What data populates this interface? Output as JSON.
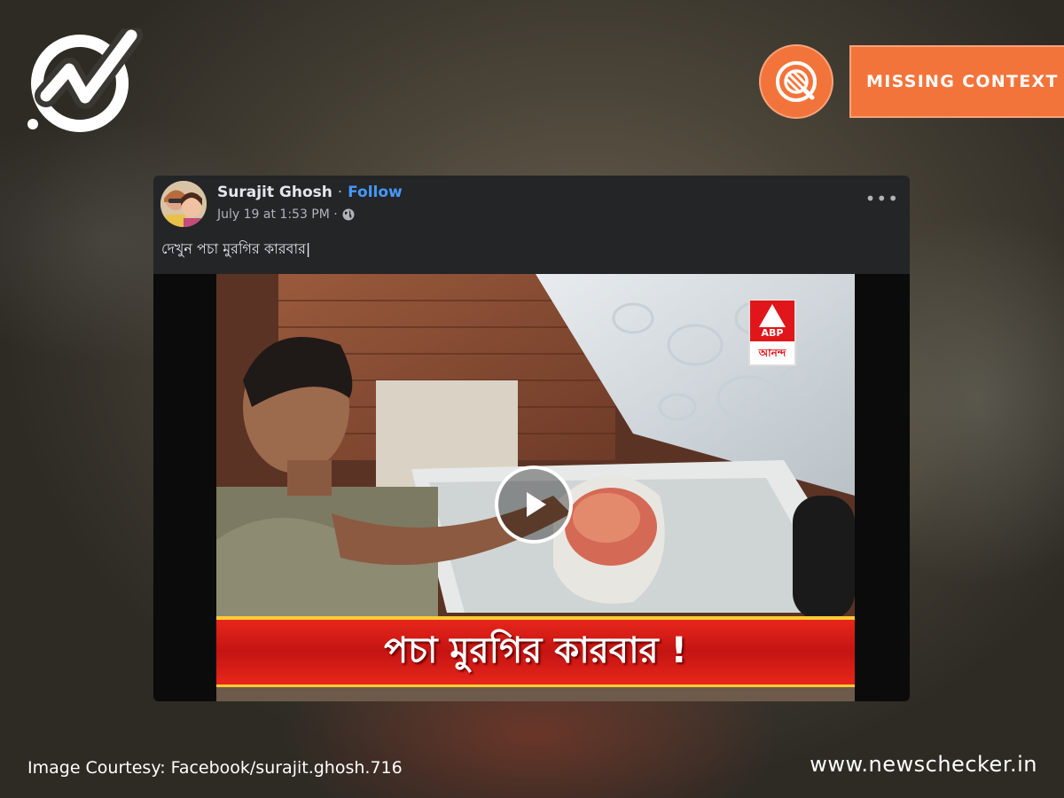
{
  "badge": {
    "label": "MISSING CONTEXT",
    "color": "#f3743a",
    "icon": "fact-check-magnifier-icon"
  },
  "logo": {
    "icon": "newschecker-check-logo-icon"
  },
  "post": {
    "author": "Surajit Ghosh",
    "separator": "·",
    "follow": "Follow",
    "timestamp": "July 19 at 1:53 PM ·",
    "audience_icon": "globe-icon",
    "more_icon": "more-options-icon",
    "caption": "দেখুন পচা মুরগির কারবার|"
  },
  "video": {
    "channel_logo": {
      "top": "ABP",
      "bottom": "আনন্দ"
    },
    "ticker": "পচা মুরগির কারবার !",
    "play_icon": "play-icon"
  },
  "footer": {
    "courtesy": "Image Courtesy: Facebook/surajit.ghosh.716",
    "site": "www.newschecker.in"
  }
}
